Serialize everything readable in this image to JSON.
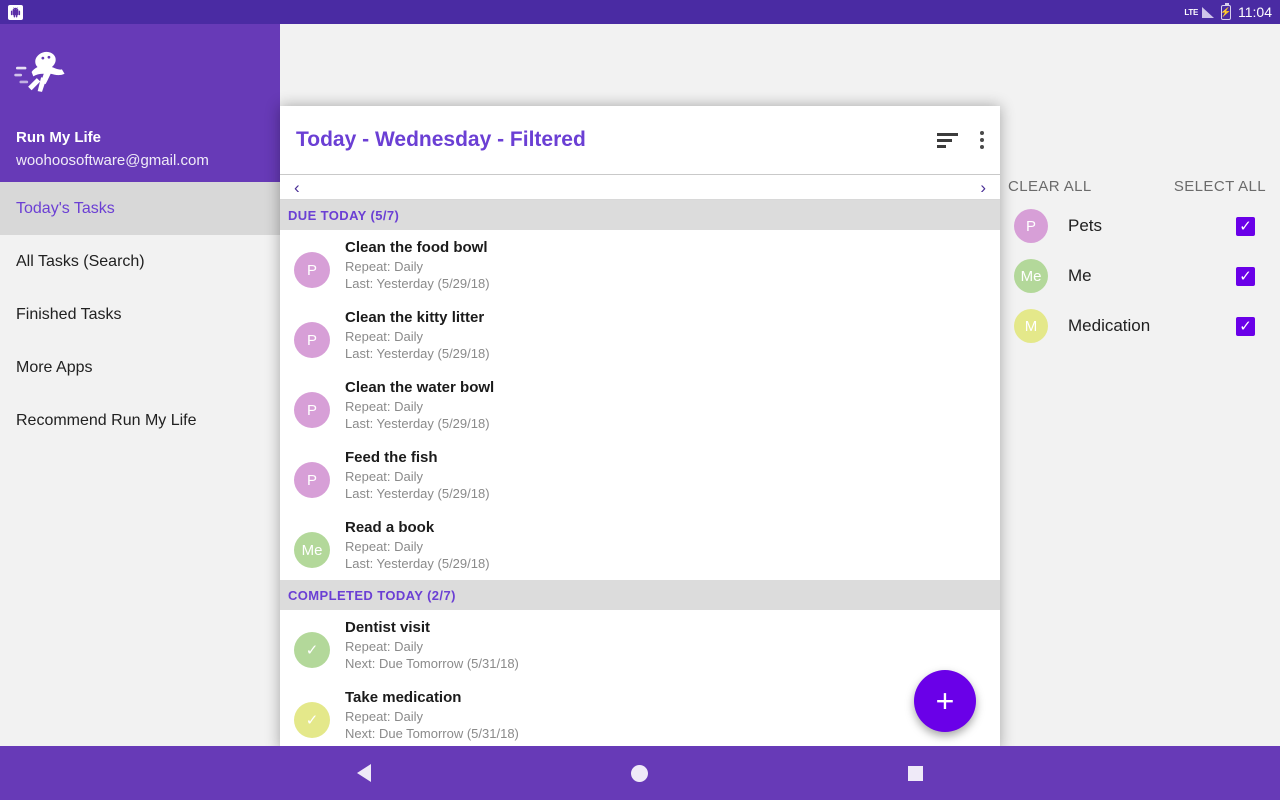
{
  "status_bar": {
    "app_icon": "app-notification-icon",
    "network_label": "LTE",
    "signal_icon": "signal-bars-icon",
    "battery_icon": "battery-charging-icon",
    "time": "11:04"
  },
  "drawer": {
    "logo_icon": "running-android-logo",
    "account_name": "Run My Life",
    "account_email": "woohoosoftware@gmail.com",
    "items": [
      {
        "label": "Today's Tasks",
        "selected": true
      },
      {
        "label": "All Tasks (Search)",
        "selected": false
      },
      {
        "label": "Finished Tasks",
        "selected": false
      },
      {
        "label": "More Apps",
        "selected": false
      },
      {
        "label": "Recommend Run My Life",
        "selected": false
      }
    ]
  },
  "dialog": {
    "title": "Today - Wednesday - Filtered",
    "sort_icon": "sort-icon",
    "overflow_icon": "more-vertical-icon",
    "pager": {
      "prev_icon": "chevron-left-icon",
      "prev": "‹",
      "next_icon": "chevron-right-icon",
      "next": "›"
    },
    "fab_label": "+",
    "sections": [
      {
        "header": "DUE TODAY (5/7)",
        "tasks": [
          {
            "avatar": "P",
            "avatar_color": "#d79fd7",
            "title": "Clean the food bowl",
            "line1": "Repeat: Daily",
            "line2": "Last: Yesterday (5/29/18)"
          },
          {
            "avatar": "P",
            "avatar_color": "#d79fd7",
            "title": "Clean the kitty litter",
            "line1": "Repeat: Daily",
            "line2": "Last: Yesterday (5/29/18)"
          },
          {
            "avatar": "P",
            "avatar_color": "#d79fd7",
            "title": "Clean the water bowl",
            "line1": "Repeat: Daily",
            "line2": "Last: Yesterday (5/29/18)"
          },
          {
            "avatar": "P",
            "avatar_color": "#d79fd7",
            "title": "Feed the fish",
            "line1": "Repeat: Daily",
            "line2": "Last: Yesterday (5/29/18)"
          },
          {
            "avatar": "Me",
            "avatar_color": "#b3d89a",
            "title": "Read a book",
            "line1": "Repeat: Daily",
            "line2": "Last: Yesterday (5/29/18)"
          }
        ]
      },
      {
        "header": "COMPLETED TODAY (2/7)",
        "tasks": [
          {
            "avatar": "✓",
            "avatar_color": "#b3d89a",
            "title": "Dentist visit",
            "line1": "Repeat: Daily",
            "line2": "Next: Due Tomorrow (5/31/18)"
          },
          {
            "avatar": "✓",
            "avatar_color": "#e4e88a",
            "title": "Take medication",
            "line1": "Repeat: Daily",
            "line2": "Next: Due Tomorrow (5/31/18)"
          }
        ]
      }
    ]
  },
  "filter_panel": {
    "clear_all": "CLEAR ALL",
    "select_all": "SELECT ALL",
    "check_glyph": "✓",
    "rows": [
      {
        "avatar": "P",
        "avatar_color": "#d79fd7",
        "label": "Pets",
        "checked": true
      },
      {
        "avatar": "Me",
        "avatar_color": "#b3d89a",
        "label": "Me",
        "checked": true
      },
      {
        "avatar": "M",
        "avatar_color": "#e4e88a",
        "label": "Medication",
        "checked": true
      }
    ]
  },
  "navbar": {
    "back_icon": "nav-back-icon",
    "home_icon": "nav-home-icon",
    "recents_icon": "nav-recents-icon"
  },
  "colors": {
    "status_bar": "#4a2ba3",
    "primary": "#673ab7",
    "accent": "#6b3fd4",
    "fab": "#6a00e8",
    "checkbox": "#6a00e8",
    "section_header_bg": "#dcdcdc"
  }
}
